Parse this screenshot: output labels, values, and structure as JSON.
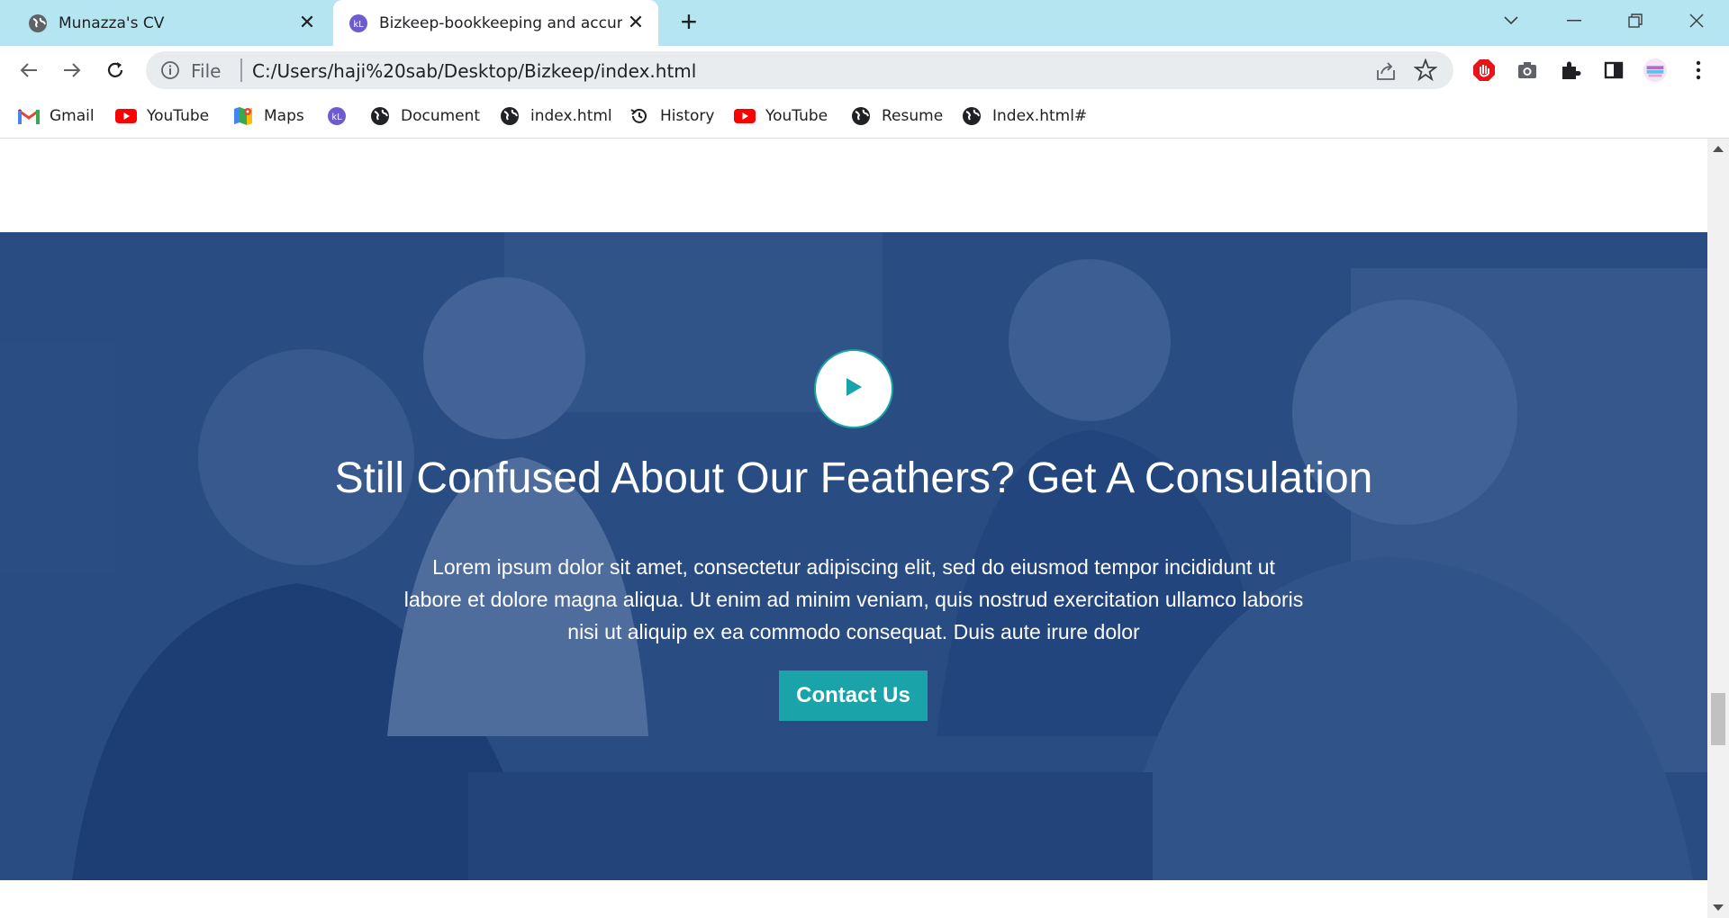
{
  "browser": {
    "tabs": [
      {
        "title": "Munazza's CV",
        "icon": "globe-icon",
        "active": false
      },
      {
        "title": "Bizkeep-bookkeeping and accun",
        "icon": "site-logo-icon",
        "active": true
      }
    ],
    "new_tab": "+",
    "window_controls": [
      "minimize-icon",
      "restore-icon",
      "close-icon"
    ],
    "address_bar": {
      "scheme": "File",
      "url": "C:/Users/haji%20sab/Desktop/Bizkeep/index.html"
    },
    "bookmarks": [
      {
        "label": "Gmail",
        "icon": "gmail-icon"
      },
      {
        "label": "YouTube",
        "icon": "youtube-icon"
      },
      {
        "label": "Maps",
        "icon": "maps-icon"
      },
      {
        "label": "",
        "icon": "site-logo-icon"
      },
      {
        "label": "Document",
        "icon": "globe-icon"
      },
      {
        "label": "index.html",
        "icon": "globe-icon"
      },
      {
        "label": "History",
        "icon": "history-icon"
      },
      {
        "label": "YouTube",
        "icon": "youtube-icon"
      },
      {
        "label": "Resume",
        "icon": "globe-icon"
      },
      {
        "label": "Index.html#",
        "icon": "globe-icon"
      }
    ]
  },
  "hero": {
    "title": "Still Confused About Our Feathers? Get A Consulation",
    "text": "Lorem ipsum dolor sit amet, consectetur adipiscing elit, sed do eiusmod tempor incididunt ut labore et dolore magna aliqua. Ut enim ad minim veniam, quis nostrud exercitation ullamco laboris nisi ut aliquip ex ea commodo consequat. Duis aute irure dolor",
    "button": "Contact Us",
    "play_icon": "play-icon"
  },
  "colors": {
    "tab_strip": "#b5e5f1",
    "hero_overlay": "#1c3e76",
    "accent": "#1aa3a8"
  }
}
